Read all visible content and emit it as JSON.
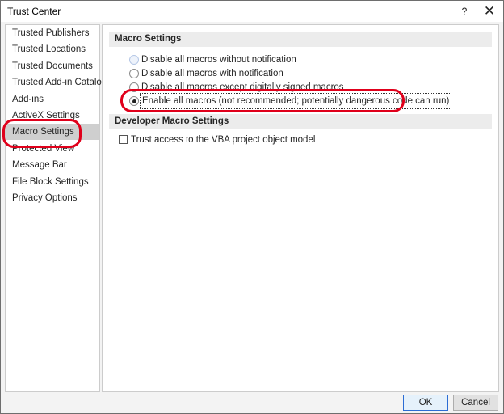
{
  "window": {
    "title": "Trust Center",
    "help_glyph": "?",
    "close_glyph": "✕"
  },
  "sidebar": {
    "items": [
      {
        "label": "Trusted Publishers"
      },
      {
        "label": "Trusted Locations"
      },
      {
        "label": "Trusted Documents"
      },
      {
        "label": "Trusted Add-in Catalogs"
      },
      {
        "label": "Add-ins"
      },
      {
        "label": "ActiveX Settings"
      },
      {
        "label": "Macro Settings",
        "selected": true
      },
      {
        "label": "Protected View"
      },
      {
        "label": "Message Bar"
      },
      {
        "label": "File Block Settings"
      },
      {
        "label": "Privacy Options"
      }
    ]
  },
  "macro_settings": {
    "header": "Macro Settings",
    "options": [
      {
        "label": "Disable all macros without notification",
        "checked": false
      },
      {
        "label": "Disable all macros with notification",
        "checked": false
      },
      {
        "label": "Disable all macros except digitally signed macros",
        "checked": false
      },
      {
        "label": "Enable all macros (not recommended; potentially dangerous code can run)",
        "checked": true
      }
    ]
  },
  "developer_macro_settings": {
    "header": "Developer Macro Settings",
    "trust_vba_label": "Trust access to the VBA project object model",
    "trust_vba_checked": false
  },
  "buttons": {
    "ok": "OK",
    "cancel": "Cancel"
  },
  "colors": {
    "highlight_ellipse": "#e0001b",
    "selected_item_bg": "#cfcfcf",
    "section_header_bg": "#ececec"
  }
}
